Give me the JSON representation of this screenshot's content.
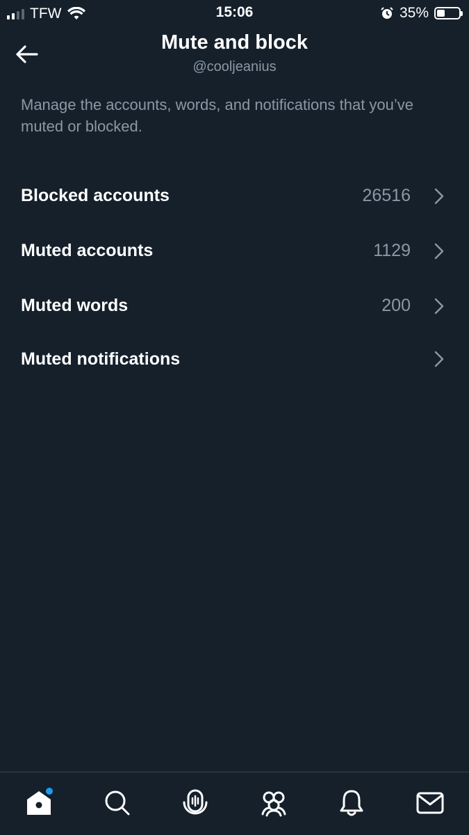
{
  "status_bar": {
    "carrier": "TFW",
    "time": "15:06",
    "battery_percent": "35%",
    "battery_level": 0.35
  },
  "header": {
    "title": "Mute and block",
    "subtitle": "@cooljeanius"
  },
  "description": "Manage the accounts, words, and notifications that you’ve muted or blocked.",
  "menu": {
    "items": [
      {
        "label": "Blocked accounts",
        "count": "26516"
      },
      {
        "label": "Muted accounts",
        "count": "1129"
      },
      {
        "label": "Muted words",
        "count": "200"
      },
      {
        "label": "Muted notifications",
        "count": ""
      }
    ]
  },
  "bottom_nav": {
    "tabs": [
      "home-icon",
      "search-icon",
      "spaces-icon",
      "communities-icon",
      "notifications-icon",
      "messages-icon"
    ]
  },
  "colors": {
    "background": "#15202b",
    "secondary_text": "#8b98a5",
    "accent": "#1d9bf0",
    "divider": "#38444d"
  }
}
